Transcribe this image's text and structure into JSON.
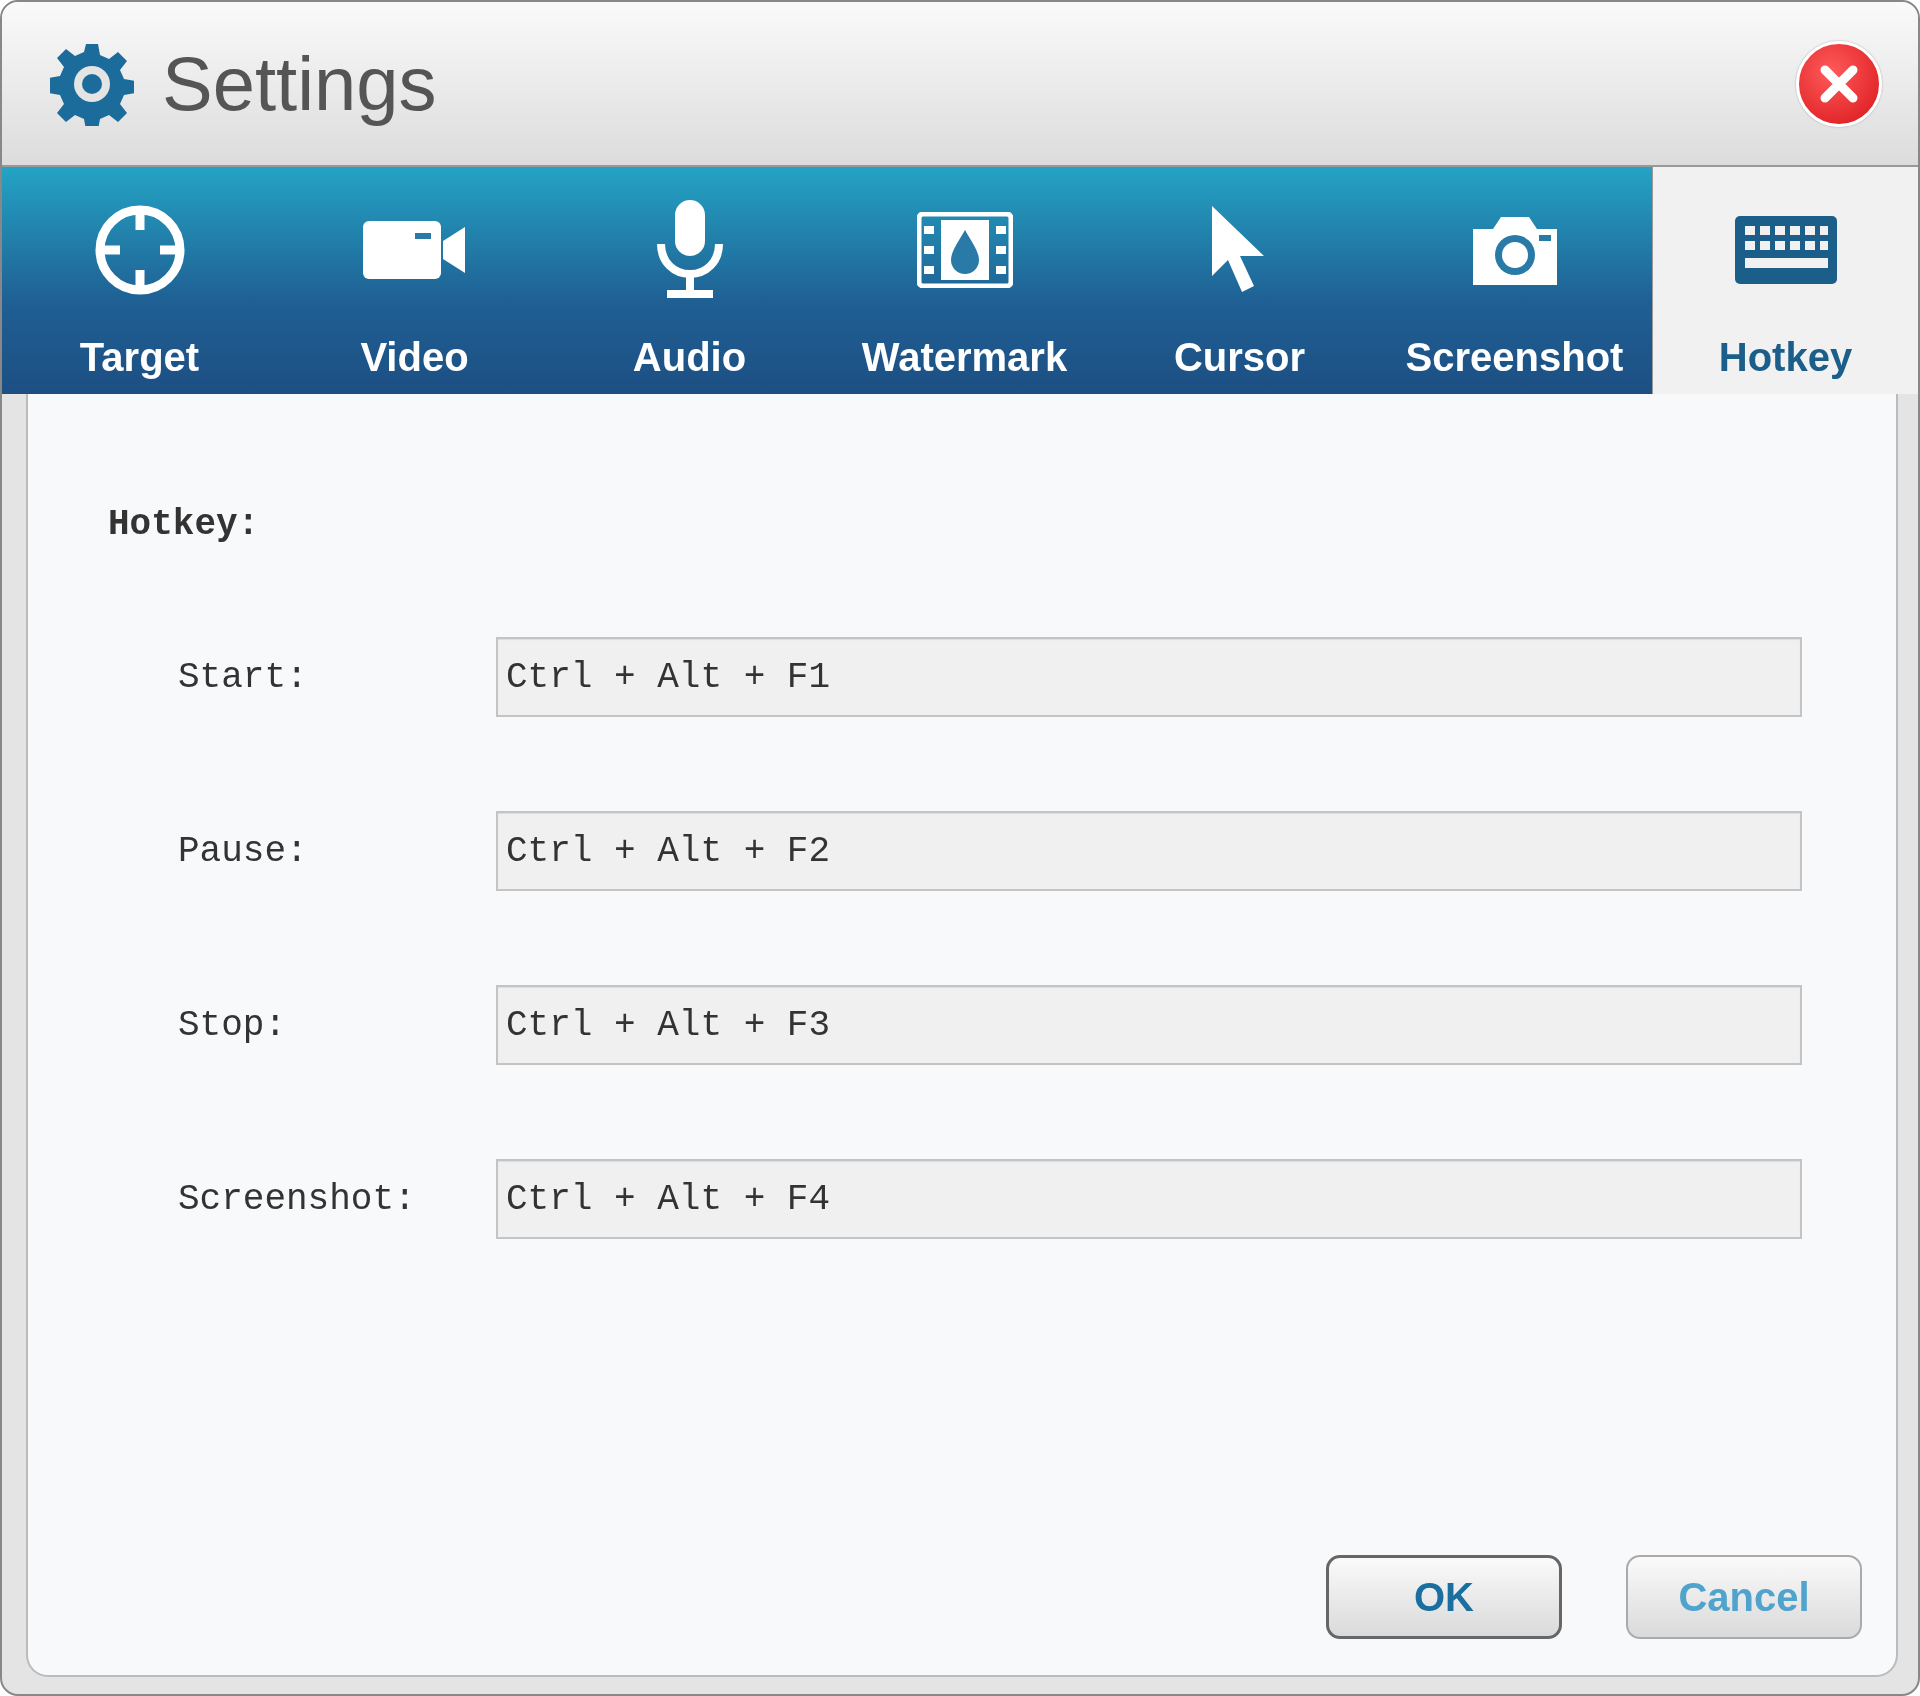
{
  "window": {
    "title": "Settings"
  },
  "tabs": [
    {
      "label": "Target",
      "kind": "target",
      "selected": false
    },
    {
      "label": "Video",
      "kind": "video",
      "selected": false
    },
    {
      "label": "Audio",
      "kind": "audio",
      "selected": false
    },
    {
      "label": "Watermark",
      "kind": "watermark",
      "selected": false
    },
    {
      "label": "Cursor",
      "kind": "cursor",
      "selected": false
    },
    {
      "label": "Screenshot",
      "kind": "screenshot",
      "selected": false
    },
    {
      "label": "Hotkey",
      "kind": "hotkey",
      "selected": true
    }
  ],
  "section": {
    "heading": "Hotkey:"
  },
  "hotkeys": [
    {
      "label": "Start:",
      "value": "Ctrl + Alt + F1"
    },
    {
      "label": "Pause:",
      "value": "Ctrl + Alt + F2"
    },
    {
      "label": "Stop:",
      "value": "Ctrl + Alt + F3"
    },
    {
      "label": "Screenshot:",
      "value": "Ctrl + Alt + F4"
    }
  ],
  "buttons": [
    {
      "label": "OK",
      "kind": "primary"
    },
    {
      "label": "Cancel",
      "kind": "secondary"
    }
  ]
}
